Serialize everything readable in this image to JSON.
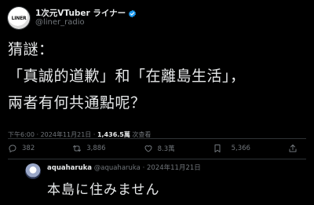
{
  "colors": {
    "background": "#000000",
    "text": "#e7e9ea",
    "muted": "#71767b",
    "verified": "#1d9bf0"
  },
  "post": {
    "avatar_text": "LINER",
    "display_name": "1次元VTuber ライナー",
    "verified_icon": "verified-badge-icon",
    "handle": "@liner_radio",
    "text": "猜謎：\n「真誠的道歉」和「在離島生活」，\n兩者有何共通點呢？",
    "timestamp": "下午6:00 · 2024年11月21日 · ",
    "views_count": "1,436.5萬",
    "views_label": " 次查看"
  },
  "actions": {
    "reply": {
      "icon": "reply-icon",
      "count": "382"
    },
    "repost": {
      "icon": "repost-icon",
      "count": "3,886"
    },
    "like": {
      "icon": "heart-icon",
      "count": "8.3萬"
    },
    "bookmark": {
      "icon": "bookmark-icon",
      "count": "5,366"
    },
    "share": {
      "icon": "share-icon"
    }
  },
  "reply": {
    "display_name": "aquaharuka",
    "handle_and_date": " @aquaharuka · 2024年11月21日",
    "text": "本島に住みません"
  }
}
